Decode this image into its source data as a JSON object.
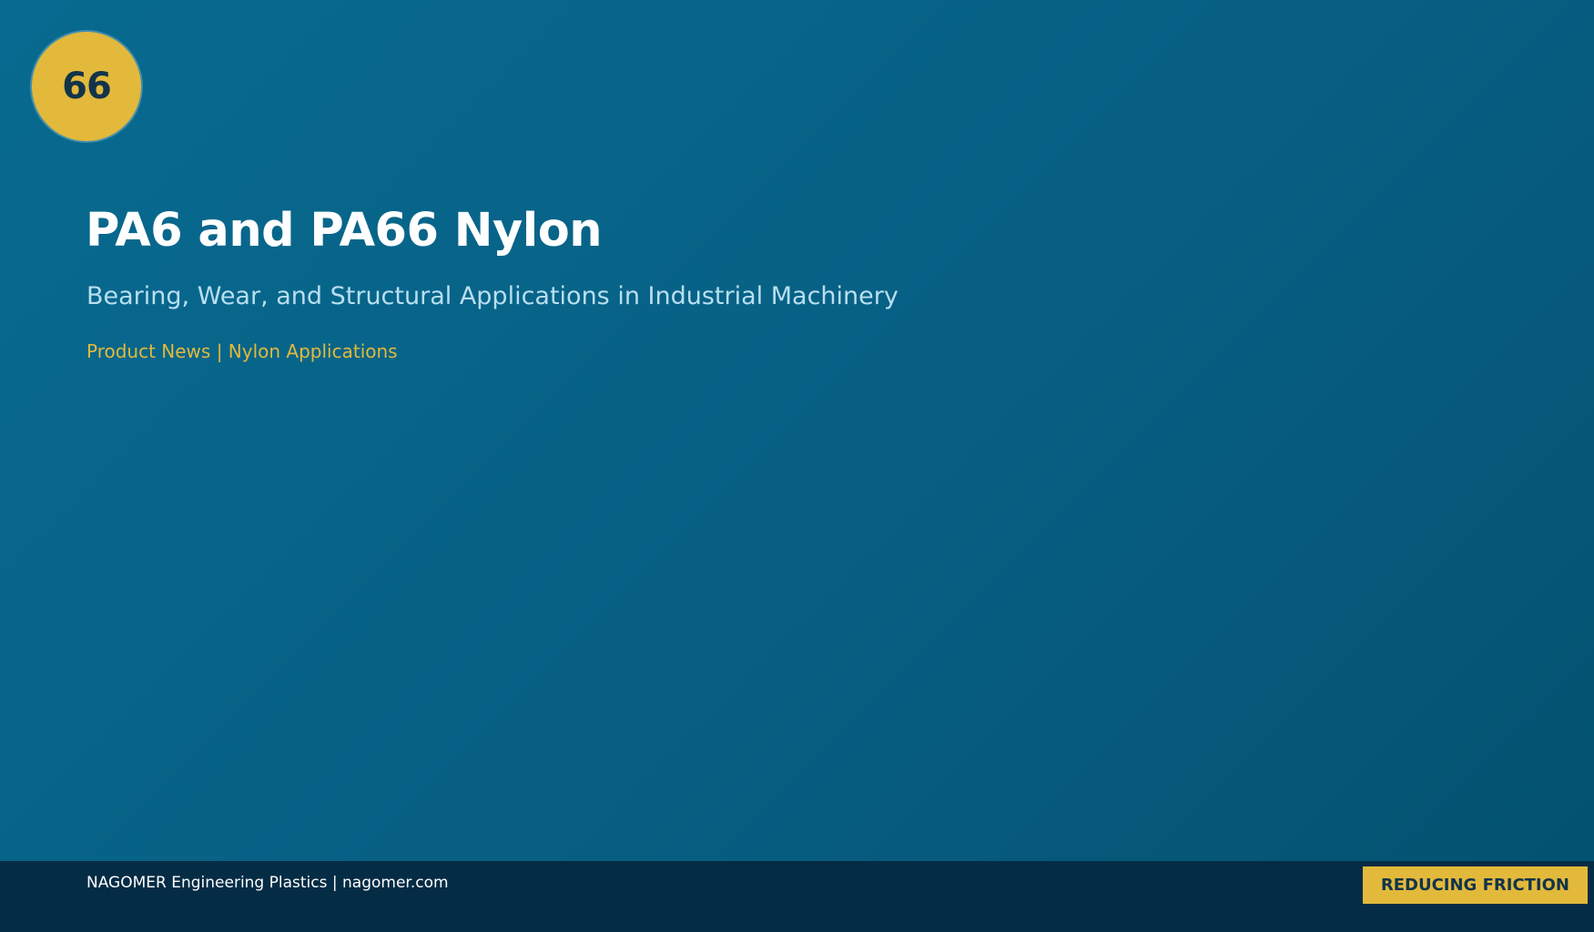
{
  "badge": {
    "number": "66",
    "color": "#e2b93b"
  },
  "header": {
    "title": "PA6 and PA66 Nylon",
    "subtitle": "Bearing, Wear, and Structural Applications in Industrial Machinery",
    "category": "Product News | Nylon Applications"
  },
  "footer": {
    "brand_text": "NAGOMER Engineering Plastics | nagomer.com",
    "tag_label": "REDUCING FRICTION"
  },
  "colors": {
    "background": "#086a90",
    "accent": "#e2b93b",
    "footer": "#052c45"
  }
}
